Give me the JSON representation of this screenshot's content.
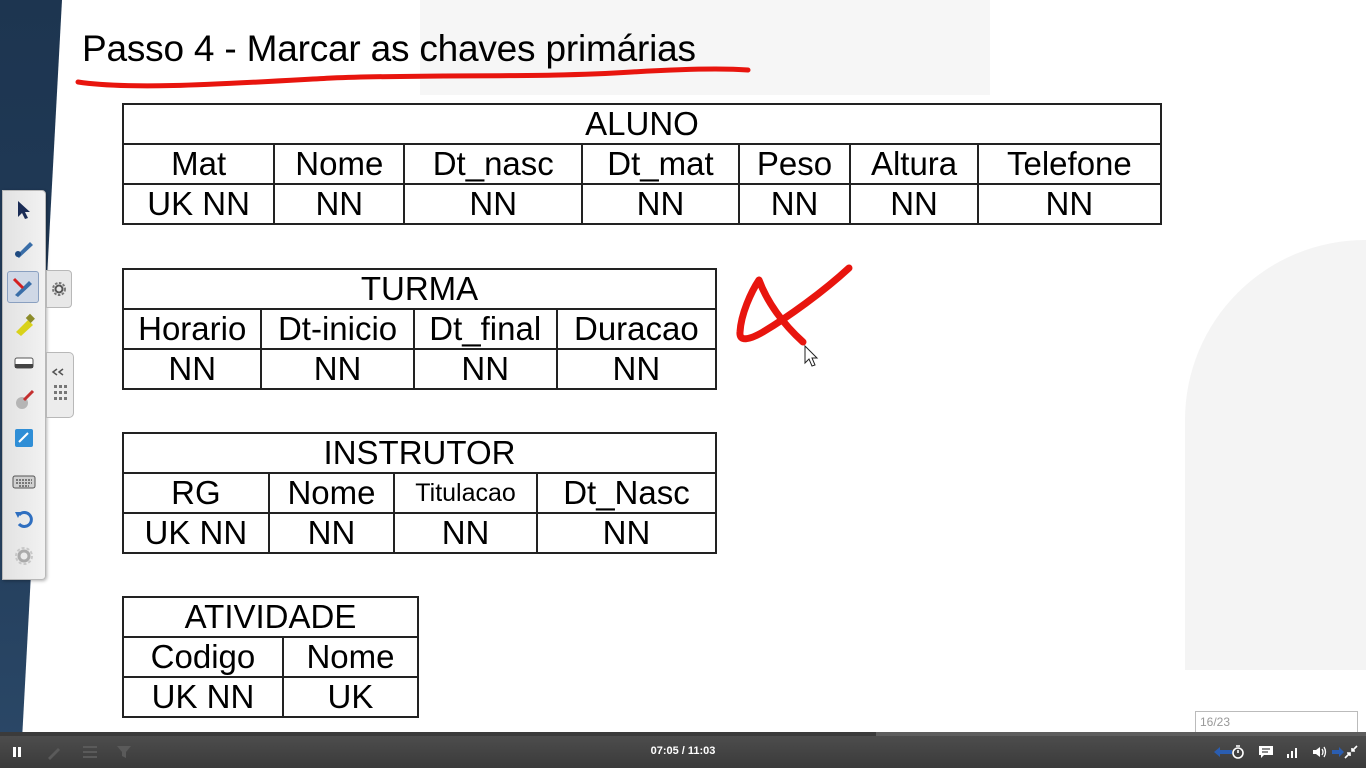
{
  "slide": {
    "title": "Passo 4 - Marcar as chaves primárias"
  },
  "tables": {
    "aluno": {
      "name": "ALUNO",
      "columns": [
        "Mat",
        "Nome",
        "Dt_nasc",
        "Dt_mat",
        "Peso",
        "Altura",
        "Telefone"
      ],
      "constraints": [
        "UK NN",
        "NN",
        "NN",
        "NN",
        "NN",
        "NN",
        "NN"
      ]
    },
    "turma": {
      "name": "TURMA",
      "columns": [
        "Horario",
        "Dt-inicio",
        "Dt_final",
        "Duracao"
      ],
      "constraints": [
        "NN",
        "NN",
        "NN",
        "NN"
      ]
    },
    "instrutor": {
      "name": "INSTRUTOR",
      "columns": [
        "RG",
        "Nome",
        "Titulacao",
        "Dt_Nasc"
      ],
      "constraints": [
        "UK NN",
        "NN",
        "NN",
        "NN"
      ]
    },
    "atividade": {
      "name": "ATIVIDADE",
      "columns": [
        "Codigo",
        "Nome"
      ],
      "constraints": [
        "UK NN",
        "UK"
      ]
    }
  },
  "annotation": {
    "ink_color": "#e8150e"
  },
  "toolbar": {
    "tools": [
      "select-arrow-icon",
      "pen-icon",
      "pen-active-icon",
      "highlighter-icon",
      "eraser-icon",
      "magic-pen-icon",
      "whiteboard-icon",
      "keyboard-icon",
      "undo-icon",
      "settings-icon"
    ]
  },
  "player": {
    "time": "07:05 / 11:03",
    "progress": 0.641,
    "page_indicator": "16/23"
  }
}
